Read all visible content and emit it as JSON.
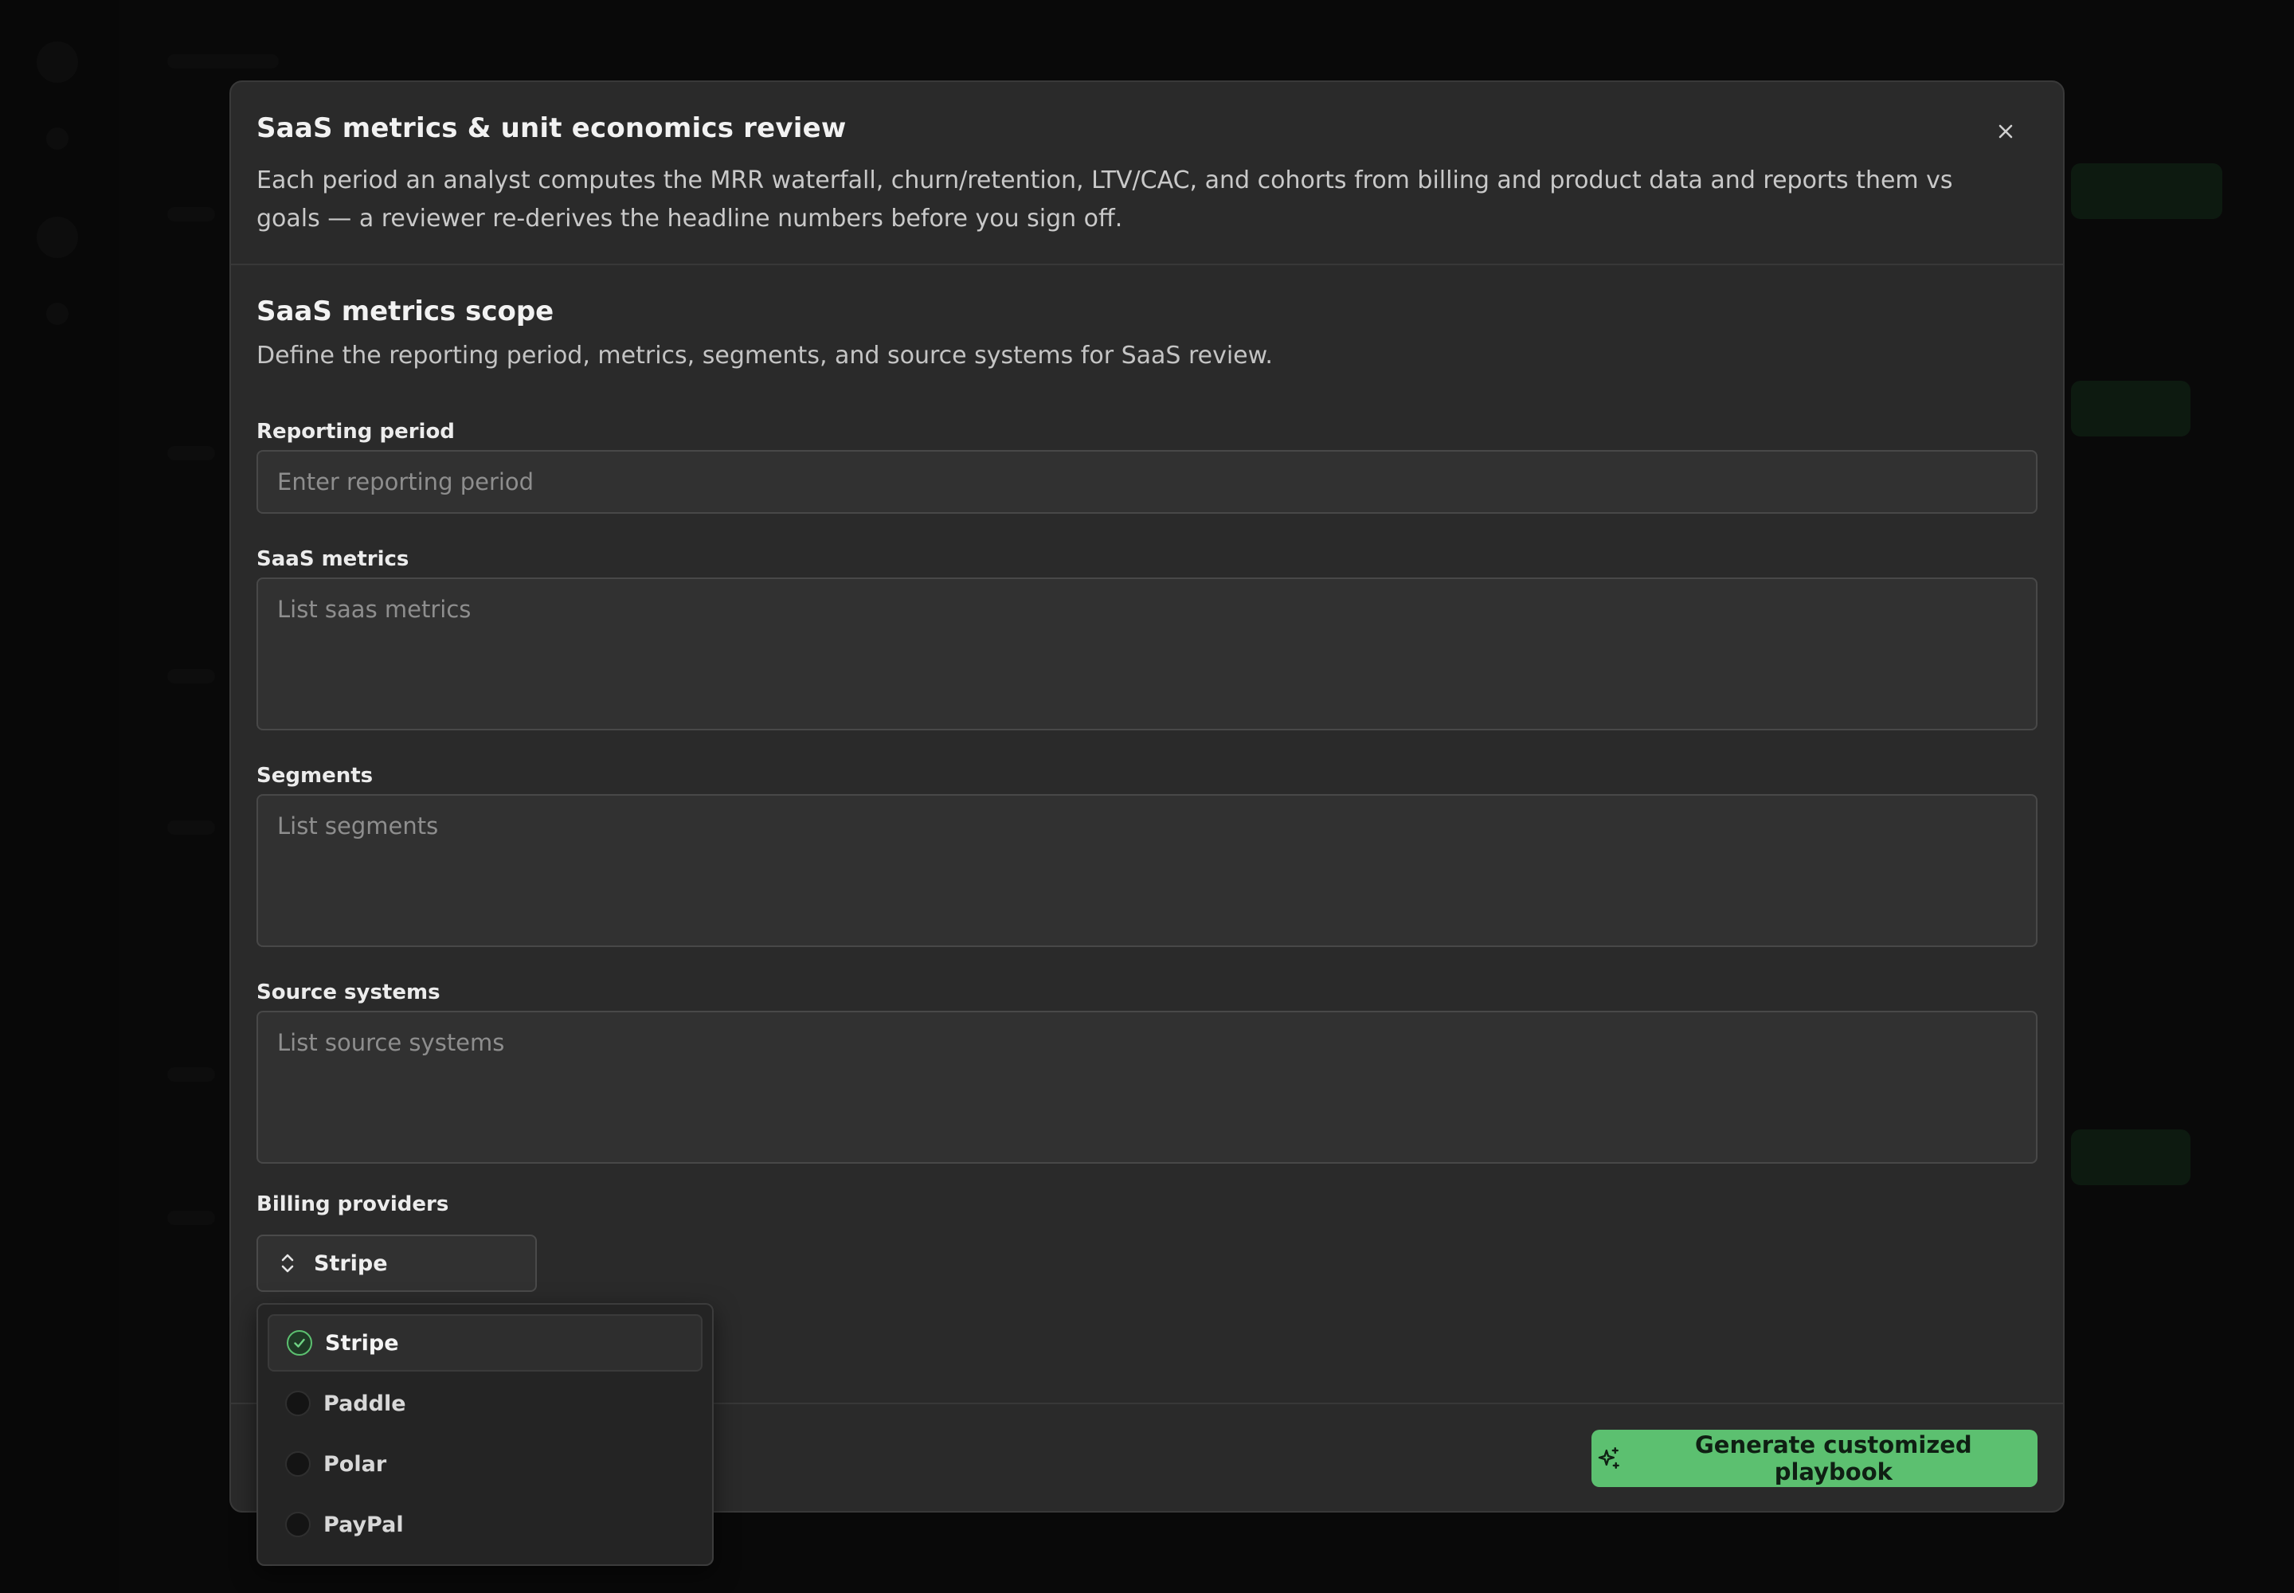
{
  "modal": {
    "title": "SaaS metrics & unit economics review",
    "description": "Each period an analyst computes the MRR waterfall, churn/retention, LTV/CAC, and cohorts from billing and product data and reports them vs goals — a reviewer re-derives the headline numbers before you sign off."
  },
  "scope": {
    "title": "SaaS metrics scope",
    "description": "Define the reporting period, metrics, segments, and source systems for SaaS review."
  },
  "fields": {
    "reporting_period": {
      "label": "Reporting period",
      "value": "",
      "placeholder": "Enter reporting period"
    },
    "saas_metrics": {
      "label": "SaaS metrics",
      "value": "",
      "placeholder": "List saas metrics"
    },
    "segments": {
      "label": "Segments",
      "value": "",
      "placeholder": "List segments"
    },
    "source_systems": {
      "label": "Source systems",
      "value": "",
      "placeholder": "List source systems"
    },
    "billing_providers": {
      "label": "Billing providers",
      "selected": "Stripe",
      "options": [
        {
          "label": "Stripe",
          "checked": true
        },
        {
          "label": "Paddle",
          "checked": false
        },
        {
          "label": "Polar",
          "checked": false
        },
        {
          "label": "PayPal",
          "checked": false
        }
      ]
    }
  },
  "footer": {
    "generate_label": "Generate customized playbook"
  },
  "colors": {
    "accent": "#5cc070",
    "modal_bg": "#2a2a2a",
    "input_bg": "#313131"
  }
}
